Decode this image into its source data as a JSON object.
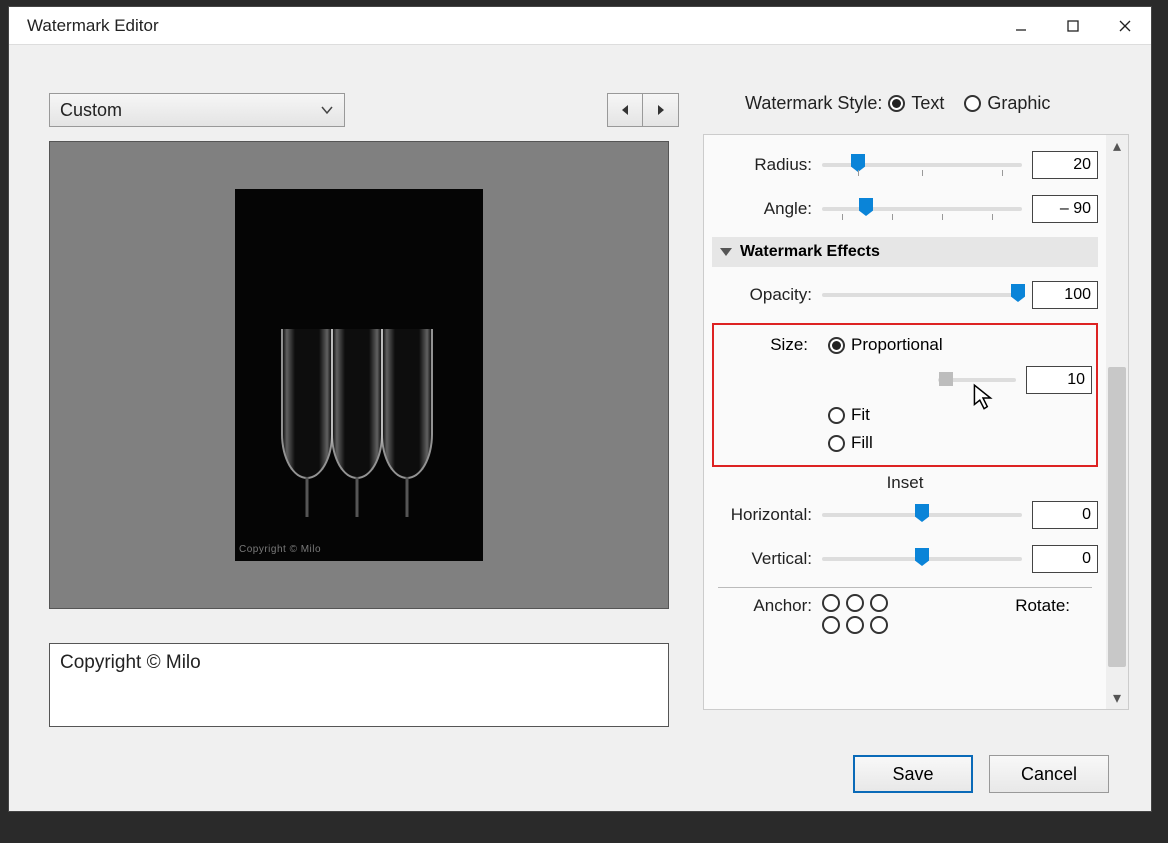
{
  "window": {
    "title": "Watermark Editor"
  },
  "preset": {
    "selected": "Custom"
  },
  "preview": {
    "copyright_tag": "Copyright © Milo"
  },
  "text_field": {
    "value": "Copyright © Milo"
  },
  "style": {
    "label": "Watermark Style:",
    "text_label": "Text",
    "graphic_label": "Graphic",
    "selected": "Text"
  },
  "controls": {
    "radius": {
      "label": "Radius:",
      "value": "20",
      "pos_pct": 18
    },
    "angle": {
      "label": "Angle:",
      "value": "– 90",
      "pos_pct": 22
    }
  },
  "effects": {
    "header": "Watermark Effects",
    "opacity": {
      "label": "Opacity:",
      "value": "100",
      "pos_pct": 100
    }
  },
  "size": {
    "label": "Size:",
    "option_proportional": "Proportional",
    "option_fit": "Fit",
    "option_fill": "Fill",
    "selected": "Proportional",
    "value": "10",
    "pos_pct": 10
  },
  "inset": {
    "header": "Inset",
    "horizontal": {
      "label": "Horizontal:",
      "value": "0",
      "pos_pct": 50
    },
    "vertical": {
      "label": "Vertical:",
      "value": "0",
      "pos_pct": 50
    }
  },
  "anchor": {
    "label": "Anchor:",
    "rotate_label": "Rotate:"
  },
  "buttons": {
    "save": "Save",
    "cancel": "Cancel"
  }
}
